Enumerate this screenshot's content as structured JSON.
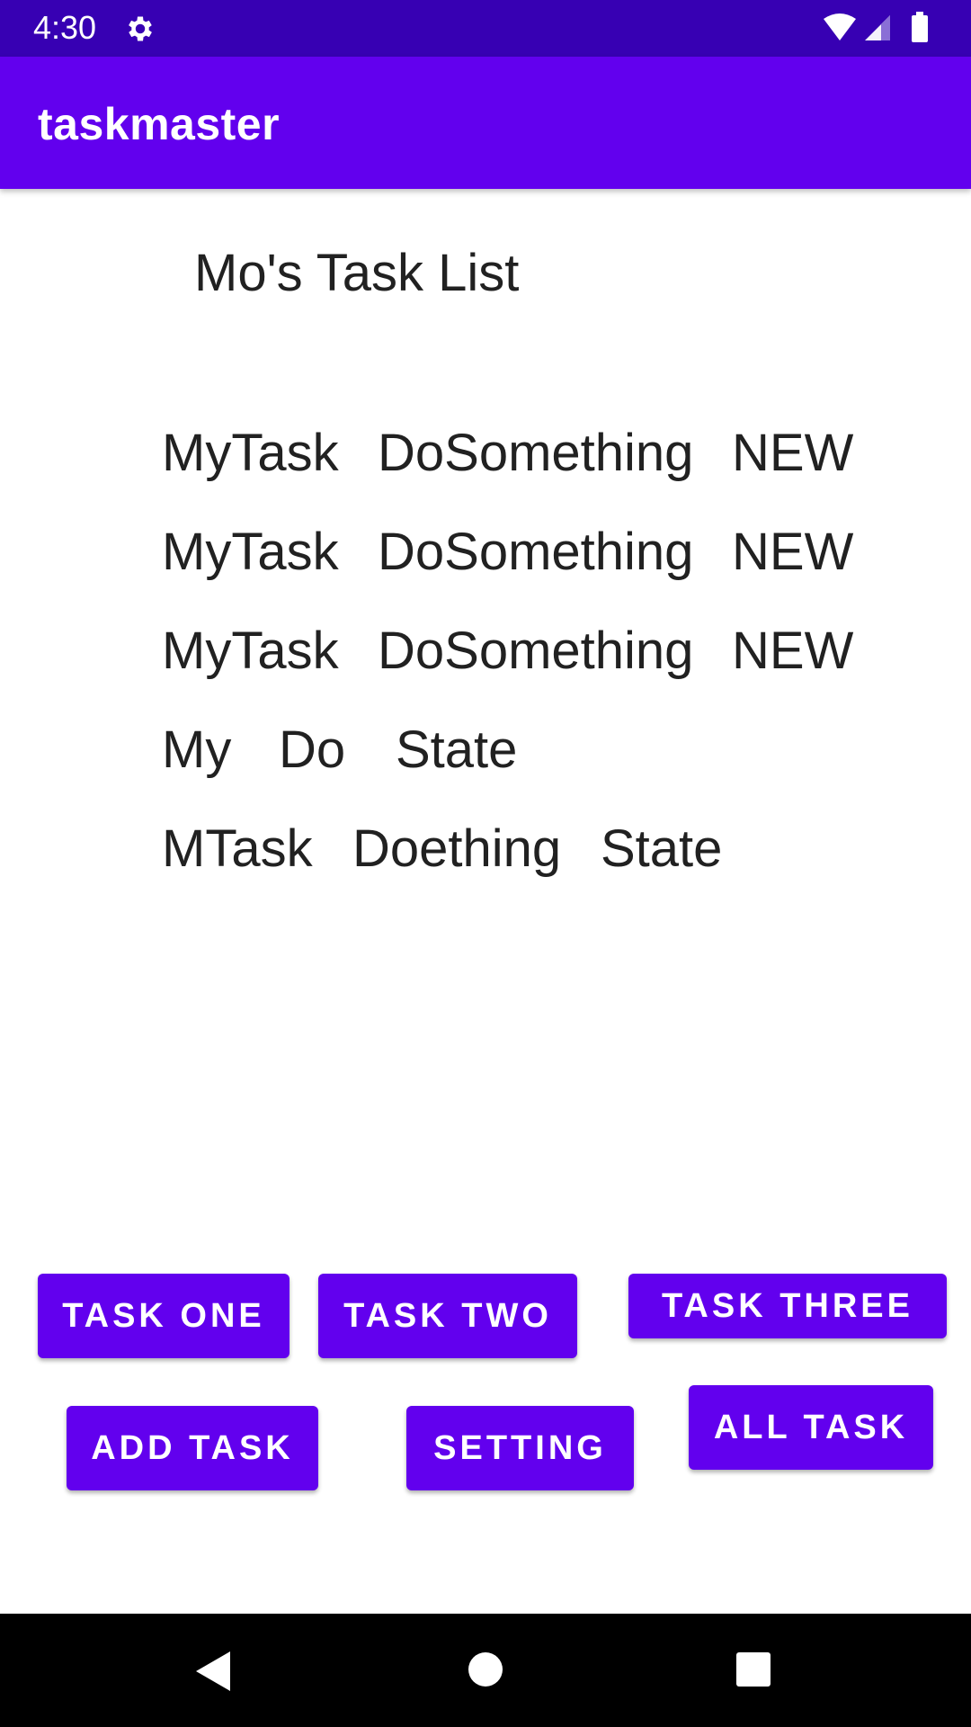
{
  "status_bar": {
    "time": "4:30",
    "icons": [
      "gear-icon",
      "wifi-icon",
      "signal-icon",
      "battery-icon"
    ]
  },
  "app_bar": {
    "title": "taskmaster",
    "color": "#6200EE"
  },
  "main": {
    "heading": "Mo's Task List",
    "tasks": [
      {
        "title": "MyTask",
        "body": "DoSomething",
        "state": "NEW"
      },
      {
        "title": "MyTask",
        "body": "DoSomething",
        "state": "NEW"
      },
      {
        "title": "MyTask",
        "body": "DoSomething",
        "state": "NEW"
      },
      {
        "title": "My",
        "body": "Do",
        "state": "State"
      },
      {
        "title": "MTask",
        "body": "Doething",
        "state": "State"
      }
    ]
  },
  "buttons": {
    "task_one": "TASK ONE",
    "task_two": "TASK TWO",
    "task_three": "TASK THREE",
    "add_task": "ADD TASK",
    "setting": "SETTING",
    "all_task": "ALL TASK"
  },
  "nav_bar": {
    "icons": [
      "back-icon",
      "home-icon",
      "recents-icon"
    ]
  },
  "colors": {
    "status_bar": "#3700B3",
    "primary": "#6200EE"
  }
}
